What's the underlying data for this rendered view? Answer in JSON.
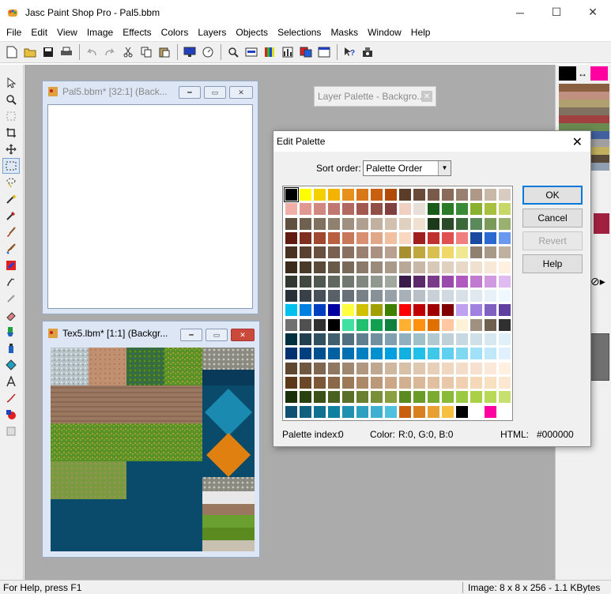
{
  "window": {
    "title": "Jasc Paint Shop Pro - Pal5.bbm",
    "minimize": "─",
    "maximize": "☐",
    "close": "✕"
  },
  "menu": [
    "File",
    "Edit",
    "View",
    "Image",
    "Effects",
    "Colors",
    "Layers",
    "Objects",
    "Selections",
    "Masks",
    "Window",
    "Help"
  ],
  "toolbar_icons": [
    "new-icon",
    "open-icon",
    "save-icon",
    "print-icon",
    "undo-icon",
    "redo-icon",
    "cut-icon",
    "copy-icon",
    "paste-icon",
    "full-screen-icon",
    "overview-icon",
    "zoom-icon",
    "toggle-toolbar-icon",
    "color-palette-icon",
    "histogram-icon",
    "layer-palette-icon",
    "tool-options-icon",
    "context-help-icon",
    "scanner-icon"
  ],
  "tools": [
    "arrow-tool-icon",
    "zoom-tool-icon",
    "deformation-tool-icon",
    "crop-tool-icon",
    "mover-tool-icon",
    "selection-tool-icon",
    "freehand-tool-icon",
    "magic-wand-icon",
    "dropper-icon",
    "paint-brush-icon",
    "clone-brush-icon",
    "color-replacer-icon",
    "retouch-tool-icon",
    "scratch-remover-icon",
    "eraser-icon",
    "picture-tube-icon",
    "airbrush-icon",
    "flood-fill-icon",
    "text-tool-icon",
    "draw-tool-icon",
    "preset-shapes-icon",
    "object-selector-icon"
  ],
  "documents": {
    "pal5": {
      "title": "Pal5.bbm* [32:1] (Back...",
      "active": false
    },
    "tex5": {
      "title": "Tex5.lbm* [1:1] (Backgr...",
      "active": true
    }
  },
  "layer_palette": {
    "title": "Layer Palette - Backgro..."
  },
  "dialog": {
    "title": "Edit Palette",
    "sort_label": "Sort order:",
    "sort_value": "Palette Order",
    "buttons": {
      "ok": "OK",
      "cancel": "Cancel",
      "revert": "Revert",
      "help": "Help"
    },
    "info": {
      "index_label": "Palette index:",
      "index_value": "0",
      "color_label": "Color:",
      "color_value": "R:0, G:0, B:0",
      "html_label": "HTML:",
      "html_value": "#000000"
    },
    "selected_index": 0,
    "palette": [
      [
        "#000000",
        "#ffff00",
        "#f5d000",
        "#f2b400",
        "#e8901e",
        "#d87818",
        "#c86010",
        "#b04c08",
        "#5a3c28",
        "#6a4a38",
        "#7a5a48",
        "#8a6a58",
        "#9a8070",
        "#b09888",
        "#c8b8a8",
        "#d8ccc0"
      ],
      [
        "#f0b0a8",
        "#e09890",
        "#d08880",
        "#c07870",
        "#b06860",
        "#a05850",
        "#905048",
        "#804040",
        "#f0d0c0",
        "#e8e0d8",
        "#1a5a1a",
        "#2a7a2a",
        "#3a8a3a",
        "#8ab030",
        "#a8c040",
        "#c8d868"
      ],
      [
        "#605040",
        "#706050",
        "#807060",
        "#908070",
        "#a09080",
        "#b0a090",
        "#c0b0a0",
        "#d0c0b0",
        "#e0d0c0",
        "#f0e0d0",
        "#1a3a1a",
        "#2a4a2a",
        "#3a6a3a",
        "#5a8a5a",
        "#7a9a5a",
        "#9ab070"
      ],
      [
        "#601a10",
        "#803020",
        "#a04830",
        "#b86040",
        "#c87858",
        "#d89070",
        "#e0a888",
        "#f0c0a0",
        "#f8d8c0",
        "#a02020",
        "#c03030",
        "#e05050",
        "#f08080",
        "#1a4aa0",
        "#2a6ad0",
        "#6a9af0"
      ],
      [
        "#4a3020",
        "#5a4030",
        "#6a5040",
        "#7a6050",
        "#8a7060",
        "#9a8070",
        "#aa9080",
        "#baa090",
        "#a89030",
        "#c0a840",
        "#d8c050",
        "#f0d868",
        "#f0e890",
        "#908070",
        "#a89888",
        "#c0b0a0"
      ],
      [
        "#3a2a1a",
        "#4a3a2a",
        "#5a4a3a",
        "#6a5a4a",
        "#7a6a5a",
        "#8a7a6a",
        "#9a8a7a",
        "#aa9a8a",
        "#b8a898",
        "#c8b8a8",
        "#d8c8b8",
        "#e0d0c0",
        "#e8d8c8",
        "#f0e0d0",
        "#f8e8d8",
        "#fff0e0"
      ],
      [
        "#303830",
        "#404840",
        "#505850",
        "#606860",
        "#707870",
        "#808880",
        "#909890",
        "#a0a8a0",
        "#3a1a4a",
        "#5a2a6a",
        "#7a3a8a",
        "#9a4aaa",
        "#b05ac0",
        "#c07ad0",
        "#d09ae0",
        "#e0baf0"
      ],
      [
        "#283038",
        "#384048",
        "#485058",
        "#586068",
        "#687078",
        "#788088",
        "#889098",
        "#98a0a8",
        "#a8b0b8",
        "#b8c0c8",
        "#c8d0d8",
        "#d0d8e0",
        "#d8e0e8",
        "#e0e8f0",
        "#e8f0f8",
        "#f0f8ff"
      ],
      [
        "#00c0f0",
        "#0080e0",
        "#0040c0",
        "#0000a0",
        "#ffff40",
        "#d0c000",
        "#a0a000",
        "#408000",
        "#ff0000",
        "#c00000",
        "#a00000",
        "#800000",
        "#c0a0f0",
        "#a080e0",
        "#8060c0",
        "#6040a0"
      ],
      [
        "#707070",
        "#505050",
        "#303030",
        "#000000",
        "#40e0a0",
        "#20c070",
        "#10a050",
        "#108040",
        "#ffb030",
        "#ff9010",
        "#e07000",
        "#ffc8a0",
        "#fff0d8",
        "#a09080",
        "#706050",
        "#303030"
      ],
      [
        "#003040",
        "#204050",
        "#305060",
        "#406070",
        "#507080",
        "#608090",
        "#7090a0",
        "#80a0b0",
        "#90b0c0",
        "#a0c0c8",
        "#b0c8d0",
        "#c0d0d8",
        "#c8d8e0",
        "#d0e0e8",
        "#d8e8f0",
        "#e0f0f8"
      ],
      [
        "#003070",
        "#004080",
        "#005090",
        "#0060a0",
        "#0070b0",
        "#0080c0",
        "#0090d0",
        "#00a0e0",
        "#10b0e0",
        "#20c0e8",
        "#40c8e8",
        "#60d0f0",
        "#80d8f0",
        "#a0e0f8",
        "#c0e8f8",
        "#e0f0ff"
      ],
      [
        "#604830",
        "#705840",
        "#806850",
        "#907860",
        "#a08870",
        "#b09880",
        "#c0a890",
        "#d0b8a0",
        "#d8c0a8",
        "#e0c8b0",
        "#e8d0b8",
        "#f0d8c0",
        "#f4dcc8",
        "#f8e0d0",
        "#fce8d8",
        "#fff0e0"
      ],
      [
        "#5a3818",
        "#6a4828",
        "#7a5838",
        "#8a6848",
        "#9a7858",
        "#aa8868",
        "#ba9878",
        "#caa888",
        "#d0b090",
        "#d8b898",
        "#e0c0a0",
        "#e8c8a8",
        "#f0d0b0",
        "#f4d8b8",
        "#f8e0c0",
        "#fce8d0"
      ],
      [
        "#1a3008",
        "#2a4010",
        "#3a5018",
        "#4a6020",
        "#5a7028",
        "#6a8030",
        "#7a9038",
        "#8aa040",
        "#5a8a20",
        "#6a9a28",
        "#7aaa30",
        "#8aba38",
        "#9aca40",
        "#aad048",
        "#b8d858",
        "#c8e070"
      ],
      [
        "#105070",
        "#106080",
        "#107090",
        "#1080a0",
        "#2090b0",
        "#30a0c0",
        "#40b0d0",
        "#50c0e0",
        "#c86010",
        "#d88020",
        "#e8a030",
        "#f8c040",
        "#000000",
        "#ffffff",
        "#ff00a0",
        "#ffffff"
      ]
    ]
  },
  "status": {
    "help": "For Help, press F1",
    "image_info": "Image:  8 x 8 x 256 - 1.1 KBytes"
  },
  "colors": {
    "foreground": "#000000",
    "background": "#ff00a0"
  }
}
